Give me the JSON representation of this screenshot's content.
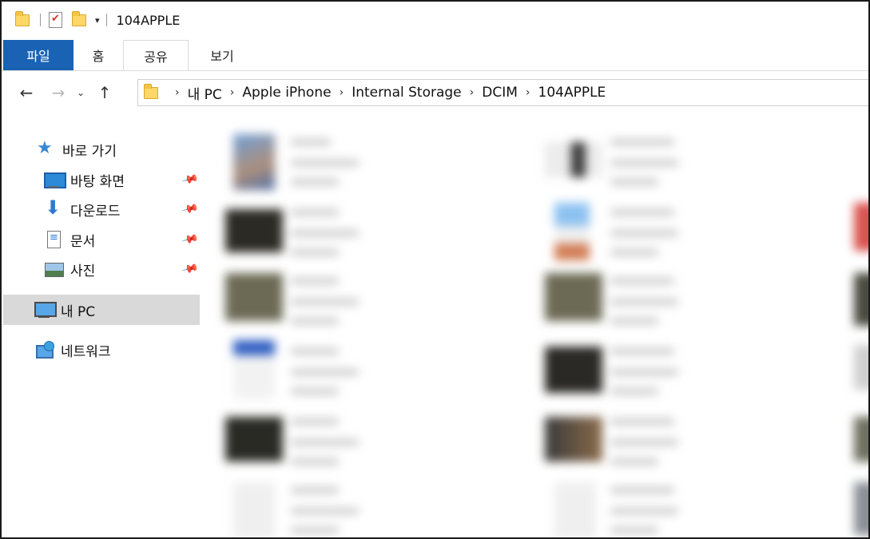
{
  "title": "104APPLE",
  "ribbon": {
    "tabs": [
      {
        "label": "파일"
      },
      {
        "label": "홈"
      },
      {
        "label": "공유"
      },
      {
        "label": "보기"
      }
    ]
  },
  "address": {
    "breadcrumbs": [
      "내 PC",
      "Apple iPhone",
      "Internal Storage",
      "DCIM",
      "104APPLE"
    ]
  },
  "sidebar": {
    "quick_access_label": "바로 가기",
    "items": [
      {
        "label": "바탕 화면",
        "icon": "desktop-icon",
        "pinned": true
      },
      {
        "label": "다운로드",
        "icon": "download-icon",
        "pinned": true
      },
      {
        "label": "문서",
        "icon": "document-icon",
        "pinned": true
      },
      {
        "label": "사진",
        "icon": "pictures-icon",
        "pinned": true
      }
    ],
    "this_pc_label": "내 PC",
    "network_label": "네트워크"
  },
  "content": {
    "blurred": true
  }
}
